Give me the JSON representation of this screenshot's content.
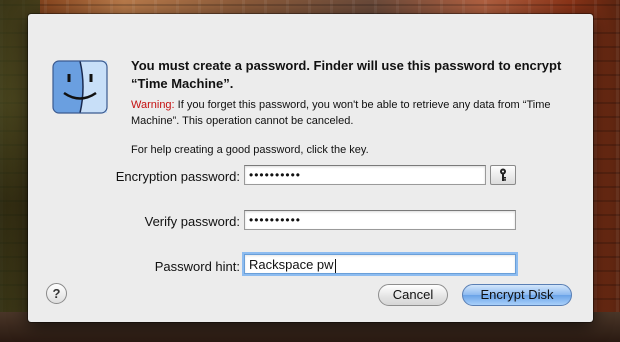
{
  "dialog": {
    "title": "You must create a password. Finder will use this password to encrypt “Time Machine”.",
    "warning_label": "Warning:",
    "warning_text": " If you forget this password, you won't be able to retrieve any data from “Time Machine”. This operation cannot be canceled.",
    "help_text": "For help creating a good password, click the key.",
    "icon": "finder-icon"
  },
  "fields": {
    "encryption_password": {
      "label": "Encryption password:",
      "value": "••••••••••"
    },
    "verify_password": {
      "label": "Verify password:",
      "value": "••••••••••"
    },
    "password_hint": {
      "label": "Password hint:",
      "value": "Rackspace pw"
    }
  },
  "buttons": {
    "help": "?",
    "cancel": "Cancel",
    "encrypt": "Encrypt Disk",
    "key_icon": "key-icon"
  },
  "colors": {
    "warning": "#c41010",
    "dialog_bg": "#ececec",
    "focus_ring": "#8dbcf0"
  }
}
